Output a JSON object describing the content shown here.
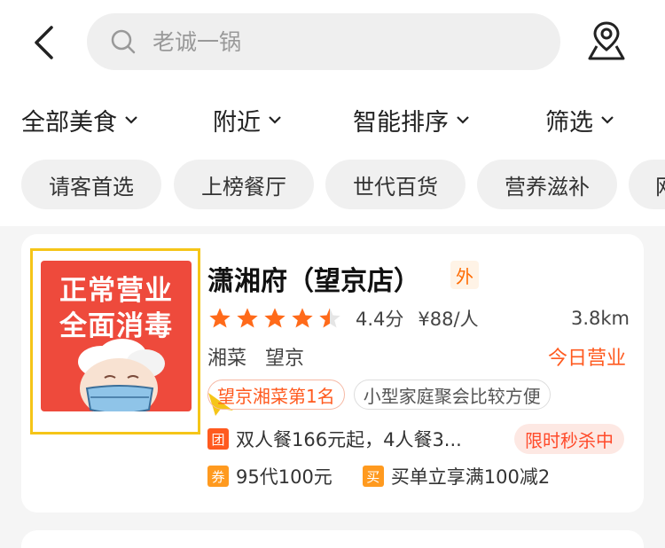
{
  "header": {
    "back_icon": "chevron-left-icon",
    "search_placeholder": "老诚一锅",
    "search_icon": "search-icon",
    "map_icon": "map-pin-icon"
  },
  "filters": [
    {
      "label": "全部美食"
    },
    {
      "label": "附近"
    },
    {
      "label": "智能排序"
    },
    {
      "label": "筛选"
    }
  ],
  "chips": [
    "请客首选",
    "上榜餐厅",
    "世代百货",
    "营养滋补",
    "网"
  ],
  "restaurant": {
    "promo_line1": "正常营业",
    "promo_line2": "全面消毒",
    "name": "潇湘府（望京店）",
    "takeout_badge": "外",
    "rating_stars": 4.5,
    "score": "4.4分",
    "price": "¥88/人",
    "distance": "3.8km",
    "cuisine": "湘菜",
    "area": "望京",
    "status": "今日营业",
    "tags": [
      "望京湘菜第1名",
      "小型家庭聚会比较方便"
    ],
    "group_badge": "团",
    "group_deal": "双人餐166元起，4人餐3...",
    "flash_sale": "限时秒杀中",
    "coupon_badge": "券",
    "coupon": "95代100元",
    "buy_badge": "买",
    "buy_deal": "买单立享满100减2"
  },
  "colors": {
    "accent": "#ff5a1f",
    "star": "#ff6a1a",
    "thumb_bg": "#ee4a3c",
    "highlight_frame": "#f5c518"
  }
}
